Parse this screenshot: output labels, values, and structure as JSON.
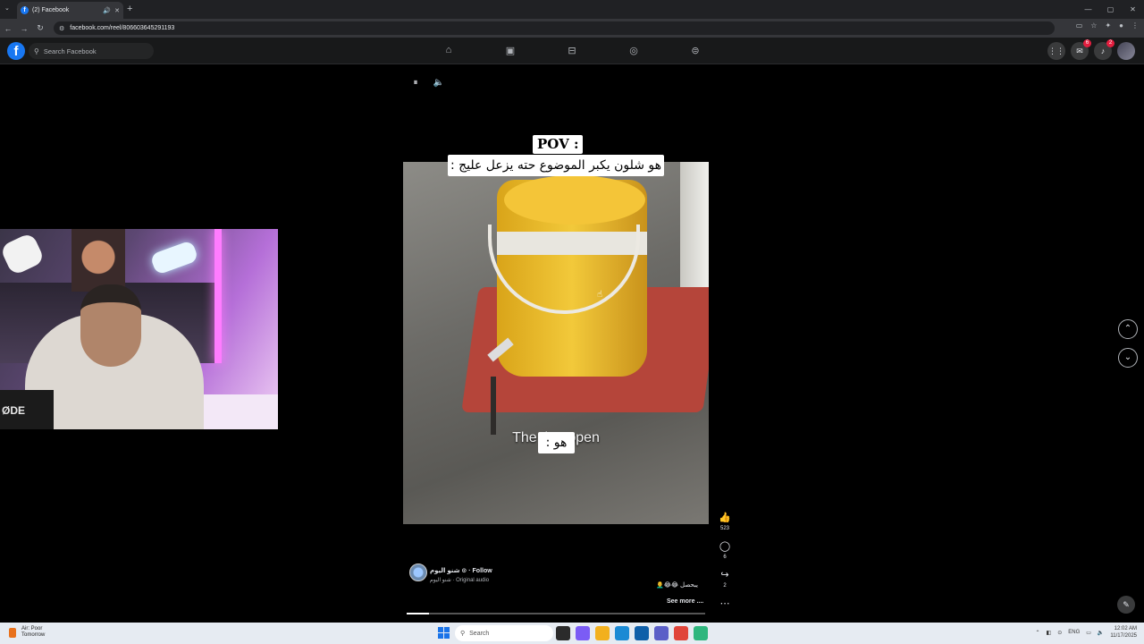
{
  "browser": {
    "tab_title": "(2) Facebook",
    "tab_favicon": "f",
    "url": "facebook.com/reel/806603645291193",
    "new_tab": "+",
    "tab_menu": "⌄",
    "window_controls": [
      "—",
      "▢",
      "✕"
    ]
  },
  "facebook": {
    "logo": "f",
    "search_placeholder": "Search Facebook",
    "nav_icons": [
      "home-icon",
      "video-icon",
      "marketplace-icon",
      "groups-icon",
      "gaming-icon"
    ],
    "messenger_badge": "6",
    "notifications_badge": "2"
  },
  "reel": {
    "pov_label": "POV :",
    "caption_top": "هو شلون يكبر الموضوع حته يزعل عليج :",
    "subtitle": "The th     s open",
    "caption_bottom": "هو :",
    "likes": "523",
    "comments": "6",
    "shares": "2",
    "author_line": "شنو اليوم ⊙ · Follow",
    "audio_line": "شنو اليوم · Original audio",
    "description": "يبحصل 😂😂👨‍🦲",
    "see_more": "See more ....",
    "progress": 0.075
  },
  "webcam": {
    "mic_label": "ØDE"
  },
  "taskbar": {
    "weather_title": "Air: Poor",
    "weather_sub": "Tomorrow",
    "search_placeholder": "Search",
    "language": "ENG",
    "time": "12:02 AM",
    "date": "11/17/2025"
  },
  "colors": {
    "facebook_blue": "#1877f2",
    "badge_red": "#e41e3f",
    "background": "#000000"
  }
}
